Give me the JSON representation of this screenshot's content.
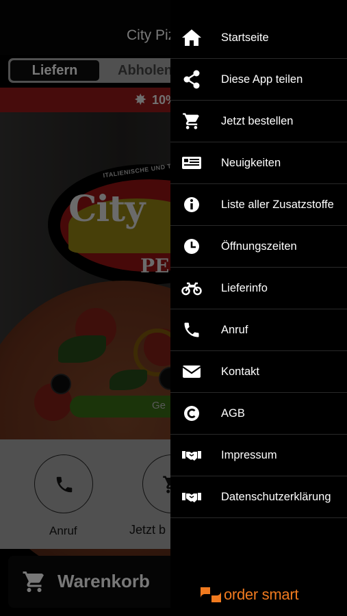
{
  "app": {
    "title": "City Piz",
    "tabs": {
      "deliver": "Liefern",
      "pickup": "Abholen"
    },
    "promo": "10%",
    "logo": {
      "strip": "ITALIENISCHE UND TÜ",
      "name": "City",
      "sub": "PE"
    },
    "order_button": "Ge",
    "quick_actions": {
      "call": "Anruf",
      "order": "Jetzt b"
    },
    "cart": "Warenkorb"
  },
  "drawer": {
    "items": [
      {
        "label": "Startseite",
        "icon": "home-icon"
      },
      {
        "label": "Diese App teilen",
        "icon": "share-icon"
      },
      {
        "label": "Jetzt bestellen",
        "icon": "cart-icon"
      },
      {
        "label": "Neuigkeiten",
        "icon": "news-icon"
      },
      {
        "label": "Liste aller Zusatzstoffe",
        "icon": "info-icon"
      },
      {
        "label": "Öffnungszeiten",
        "icon": "clock-icon"
      },
      {
        "label": "Lieferinfo",
        "icon": "motorbike-icon"
      },
      {
        "label": "Anruf",
        "icon": "phone-icon"
      },
      {
        "label": "Kontakt",
        "icon": "envelope-icon"
      },
      {
        "label": "AGB",
        "icon": "copyright-icon"
      },
      {
        "label": "Impressum",
        "icon": "handshake-icon"
      },
      {
        "label": "Datenschutzerklärung",
        "icon": "handshake-icon"
      }
    ],
    "brand": "order smart"
  },
  "colors": {
    "drawer_bg": "#000000",
    "brand_orange": "#f07a1f",
    "promo_red": "#c41f1f",
    "order_green": "#4c9a1f"
  }
}
